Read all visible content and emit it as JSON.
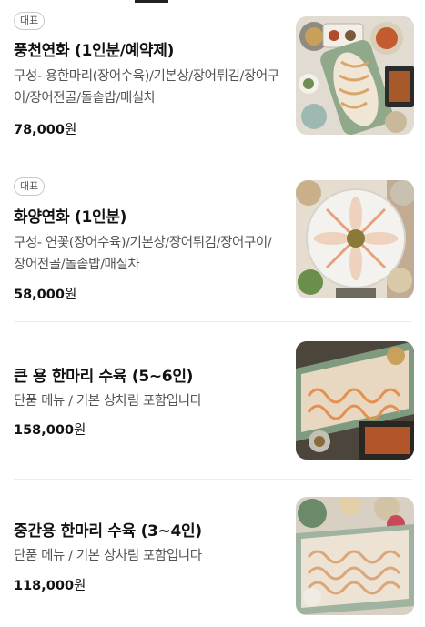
{
  "menu": {
    "items": [
      {
        "badge": "대표",
        "name": "풍천연화 (1인분/예약제)",
        "description": "구성- 용한마리(장어수육)/기본상/장어튀김/장어구이/장어전골/돌솥밥/매실차",
        "price": "78,000",
        "currency": "원"
      },
      {
        "badge": "대표",
        "name": "화양연화 (1인분)",
        "description": "구성- 연꽃(장어수육)/기본상/장어튀김/장어구이/장어전골/돌솥밥/매실차",
        "price": "58,000",
        "currency": "원"
      },
      {
        "name": "큰 용 한마리 수육 (5~6인)",
        "description": "단품 메뉴 / 기본 상차림 포함입니다",
        "price": "158,000",
        "currency": "원"
      },
      {
        "name": "중간용 한마리 수육 (3~4인)",
        "description": "단품 메뉴 / 기본 상차림 포함입니다",
        "price": "118,000",
        "currency": "원"
      }
    ]
  },
  "colors": {
    "text_primary": "#111111",
    "text_secondary": "#555555",
    "divider": "#ececec",
    "badge_border": "#c9c9c9",
    "tab_indicator": "#222222"
  }
}
